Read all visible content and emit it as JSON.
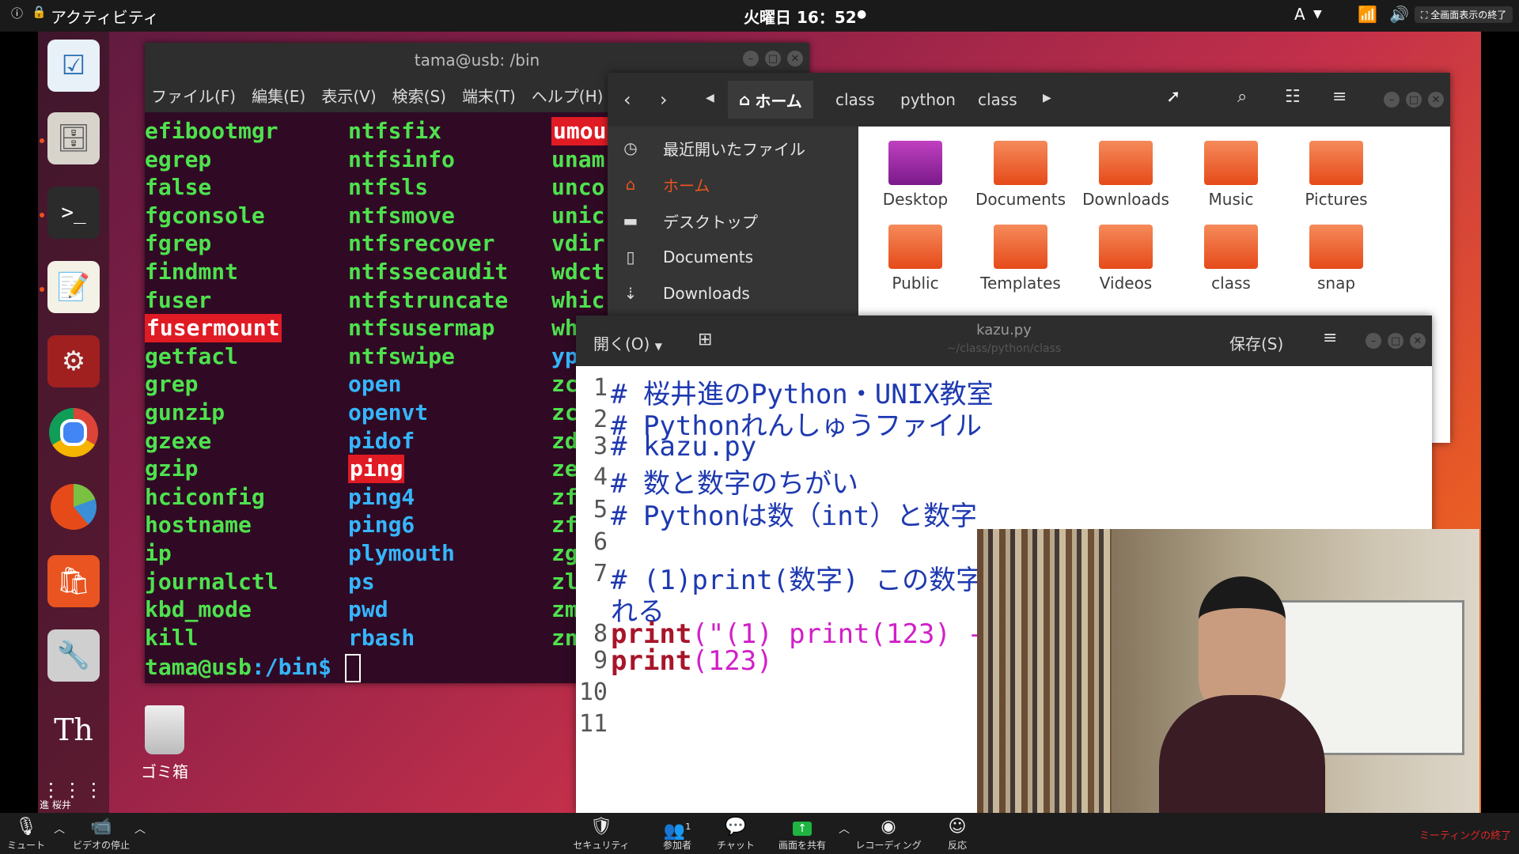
{
  "topbar": {
    "activities": "アクティビティ",
    "clock": "火曜日 16：52",
    "input_method": "A",
    "fullscreen_exit": "全画面表示の終了"
  },
  "dock": {
    "trash_label": "ゴミ箱",
    "user_name": "進 桜井"
  },
  "terminal": {
    "title": "tama@usb: /bin",
    "menu": [
      "ファイル(F)",
      "編集(E)",
      "表示(V)",
      "検索(S)",
      "端末(T)",
      "ヘルプ(H)"
    ],
    "col1": [
      "efibootmgr",
      "egrep",
      "false",
      "fgconsole",
      "fgrep",
      "findmnt",
      "fuser",
      "fusermount",
      "getfacl",
      "grep",
      "gunzip",
      "gzexe",
      "gzip",
      "hciconfig",
      "hostname",
      "ip",
      "journalctl",
      "kbd_mode",
      "kill"
    ],
    "col2": [
      "ntfsfix",
      "ntfsinfo",
      "ntfsls",
      "ntfsmove",
      "ntfsrecover",
      "ntfssecaudit",
      "ntfstruncate",
      "ntfsusermap",
      "ntfswipe",
      "open",
      "openvt",
      "pidof",
      "ping",
      "ping4",
      "ping6",
      "plymouth",
      "ps",
      "pwd",
      "rbash"
    ],
    "col3": [
      "umou",
      "unam",
      "unco",
      "unic",
      "vdir",
      "wdct",
      "whic",
      "whi",
      "yp",
      "zc",
      "zc",
      "zd",
      "ze",
      "zf",
      "zf",
      "zg",
      "zl",
      "zm",
      "zn"
    ],
    "prompt_user": "tama@usb",
    "prompt_path": ":/bin$"
  },
  "file_manager": {
    "path": [
      "ホーム",
      "class",
      "python",
      "class"
    ],
    "sidebar": [
      {
        "icon": "clock-icon",
        "label": "最近開いたファイル"
      },
      {
        "icon": "home-icon",
        "label": "ホーム"
      },
      {
        "icon": "folder-icon",
        "label": "デスクトップ"
      },
      {
        "icon": "document-icon",
        "label": "Documents"
      },
      {
        "icon": "download-icon",
        "label": "Downloads"
      }
    ],
    "folders": [
      "Desktop",
      "Documents",
      "Downloads",
      "Music",
      "Pictures",
      "Public",
      "Templates",
      "Videos",
      "class",
      "snap"
    ]
  },
  "editor": {
    "open_label": "開く(O)",
    "title": "kazu.py",
    "subtitle": "~/class/python/class",
    "save_label": "保存(S)",
    "lines": [
      {
        "n": "1",
        "text": "# 桜井進のPython・UNIX教室"
      },
      {
        "n": "2",
        "text": "# Pythonれんしゅうファイル"
      },
      {
        "n": "3",
        "text": "# kazu.py"
      },
      {
        "n": "4",
        "text": "# 数と数字のちがい"
      },
      {
        "n": "5",
        "text": "# Pythonは数（int）と数字"
      },
      {
        "n": "6",
        "text": ""
      },
      {
        "n": "7",
        "text": "# (1)print(数字) この数字"
      },
      {
        "n": "",
        "text": "れる"
      },
      {
        "n": "8",
        "kw": "print",
        "rest": "(\"(1) print(123) -"
      },
      {
        "n": "9",
        "kw": "print",
        "rest": "(123)"
      },
      {
        "n": "10",
        "text": ""
      },
      {
        "n": "11",
        "text": ""
      }
    ]
  },
  "zoom": {
    "mute": "ミュート",
    "video": "ビデオの停止",
    "security": "セキュリティ",
    "participants": "参加者",
    "participants_count": "1",
    "chat": "チャット",
    "share": "画面を共有",
    "record": "レコーディング",
    "reactions": "反応",
    "end": "ミーティングの終了"
  },
  "colors": {
    "terminal_bg": "#300a24",
    "terminal_text": "#4ee24e",
    "terminal_cyan": "#35b6ff",
    "highlight_red": "#e01b24",
    "ubuntu_orange": "#e95420"
  }
}
